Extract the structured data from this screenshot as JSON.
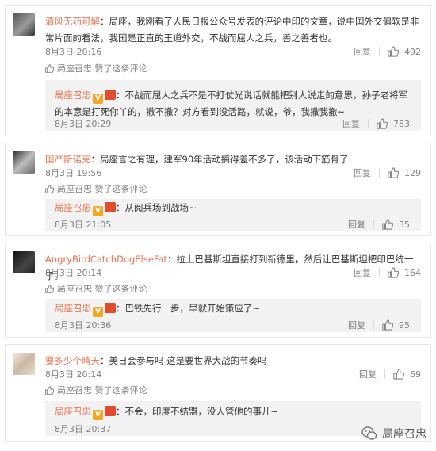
{
  "comments": [
    {
      "user": "清风无药可解",
      "text": "：局座，我刚看了人民日报公众号发表的评论中印的文章，说中国外交偏软是非常片面的看法，我国是正直的王道外交，不战而屈人之兵，善之善者也。",
      "time": "8月3日 20:16",
      "reply_label": "回复",
      "likes": "492",
      "liked_by": "局座召忠 赞了这条评论",
      "reply": {
        "user": "局座召忠",
        "text": "：不战而屈人之兵不是不打仗光说话就能把别人说走的意思，孙子老将军的本意是打死你丫的，撤不撤？对方看到没活路，就说，爷，我撤我撤~",
        "time": "8月3日 20:29",
        "reply_label": "回复",
        "likes": "783"
      }
    },
    {
      "user": "国产斯诺克",
      "text": "：局座言之有理，建军90年活动搞得差不多了，该活动下筋骨了",
      "time": "8月3日 19:56",
      "reply_label": "回复",
      "likes": "129",
      "liked_by": "局座召忠 赞了这条评论",
      "reply": {
        "user": "局座召忠",
        "text": "：从阅兵场到战场~",
        "time": "8月3日 21:05",
        "reply_label": "回复",
        "likes": "35"
      }
    },
    {
      "user": "AngryBirdCatchDogElseFat",
      "text": "：拉上巴基斯坦直接打到新德里，然后让巴基斯坦把印巴统一了。",
      "time": "8月3日 20:14",
      "reply_label": "回复",
      "likes": "164",
      "liked_by": "局座召忠 赞了这条评论",
      "reply": {
        "user": "局座召忠",
        "text": "：巴铁先行一步，早就开始策应了~",
        "time": "8月3日 20:36",
        "reply_label": "回复",
        "likes": "95"
      }
    },
    {
      "user": "要多少个晴天",
      "text": "：美日会参与吗 这是要世界大战的节奏吗",
      "time": "8月3日 20:14",
      "reply_label": "回复",
      "likes": "69",
      "liked_by": "局座召忠 赞了这条评论",
      "reply": {
        "user": "局座召忠",
        "text": "：不会，印度不结盟，没人管他的事儿~",
        "time": "8月3日 20:37",
        "reply_label": "回复",
        "likes": ""
      }
    }
  ],
  "watermark": "局座召忠",
  "colors": {
    "username": "#eb7350",
    "meta": "#808080",
    "reply_bg": "#f2f2f2"
  }
}
